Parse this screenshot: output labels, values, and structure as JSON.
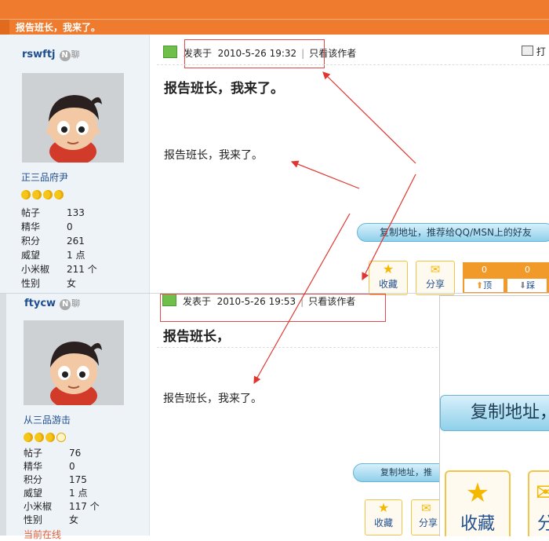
{
  "thread": {
    "title": "报告班长，我来了。"
  },
  "print_label": "打",
  "posts": [
    {
      "username": "rswftj",
      "mark": "聊",
      "rank": "正三品府尹",
      "stats": [
        {
          "k": "帖子",
          "v": "133"
        },
        {
          "k": "精华",
          "v": "0"
        },
        {
          "k": "积分",
          "v": "261"
        },
        {
          "k": "威望",
          "v": "1 点"
        },
        {
          "k": "小米椒",
          "v": "211 个"
        },
        {
          "k": "性别",
          "v": "女"
        }
      ],
      "meta": {
        "posted_label": "发表于",
        "time": "2010-5-26 19:32",
        "only_author": "只看该作者"
      },
      "subject": "报告班长，我来了。",
      "body": "报告班长，我来了。",
      "copy_label": "复制地址，推荐给QQ/MSN上的好友",
      "fav_label": "收藏",
      "share_label": "分享",
      "votes": {
        "up_count": "0",
        "down_count": "0",
        "up_label": "顶",
        "down_label": "踩"
      }
    },
    {
      "username": "ftycw",
      "mark": "聊",
      "rank": "从三品游击",
      "stats": [
        {
          "k": "帖子",
          "v": "76"
        },
        {
          "k": "精华",
          "v": "0"
        },
        {
          "k": "积分",
          "v": "175"
        },
        {
          "k": "威望",
          "v": "1 点"
        },
        {
          "k": "小米椒",
          "v": "117 个"
        },
        {
          "k": "性别",
          "v": "女"
        }
      ],
      "status": "当前在线",
      "meta": {
        "posted_label": "发表于",
        "time": "2010-5-26 19:53",
        "only_author": "只看该作者"
      },
      "subject": "报告班长，",
      "body": "报告班长，我来了。",
      "copy_label": "复制地址，推",
      "fav_label": "收藏",
      "share_label": "分享"
    }
  ],
  "zoom": {
    "copy_label": "复制地址，",
    "fav_label": "收藏",
    "share_label": "分"
  }
}
